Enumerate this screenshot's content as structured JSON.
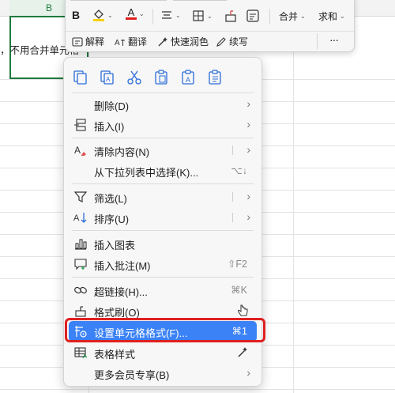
{
  "sheet": {
    "column_header": "B",
    "cell_text": "，不用合并单元格"
  },
  "toolbar": {
    "bold": "B",
    "font_color": "A",
    "merge_label": "合并",
    "sum_label": "求和",
    "explain": "解释",
    "translate": "翻译",
    "quick_color": "快速润色",
    "continue_write": "续写",
    "more": "···"
  },
  "menu": {
    "items": {
      "delete": {
        "label": "删除(D)"
      },
      "insert": {
        "label": "插入(I)"
      },
      "clear": {
        "label": "清除内容(N)"
      },
      "pick_list": {
        "label": "从下拉列表中选择(K)...",
        "shortcut": "⌥↓"
      },
      "filter": {
        "label": "筛选(L)"
      },
      "sort": {
        "label": "排序(U)"
      },
      "insert_chart": {
        "label": "插入图表"
      },
      "insert_comment": {
        "label": "插入批注(M)",
        "shortcut": "⇧F2"
      },
      "hyperlink": {
        "label": "超链接(H)...",
        "shortcut": "⌘K"
      },
      "format_painter": {
        "label": "格式刷(O)"
      },
      "format_cells": {
        "label": "设置单元格格式(F)...",
        "shortcut": "⌘1"
      },
      "table_style": {
        "label": "表格样式"
      },
      "member": {
        "label": "更多会员专享(B)"
      }
    },
    "arrow": "›"
  },
  "colors": {
    "accent": "#3b82f6",
    "annotation": "#e02020",
    "sheet_green": "#1e7b3e"
  }
}
